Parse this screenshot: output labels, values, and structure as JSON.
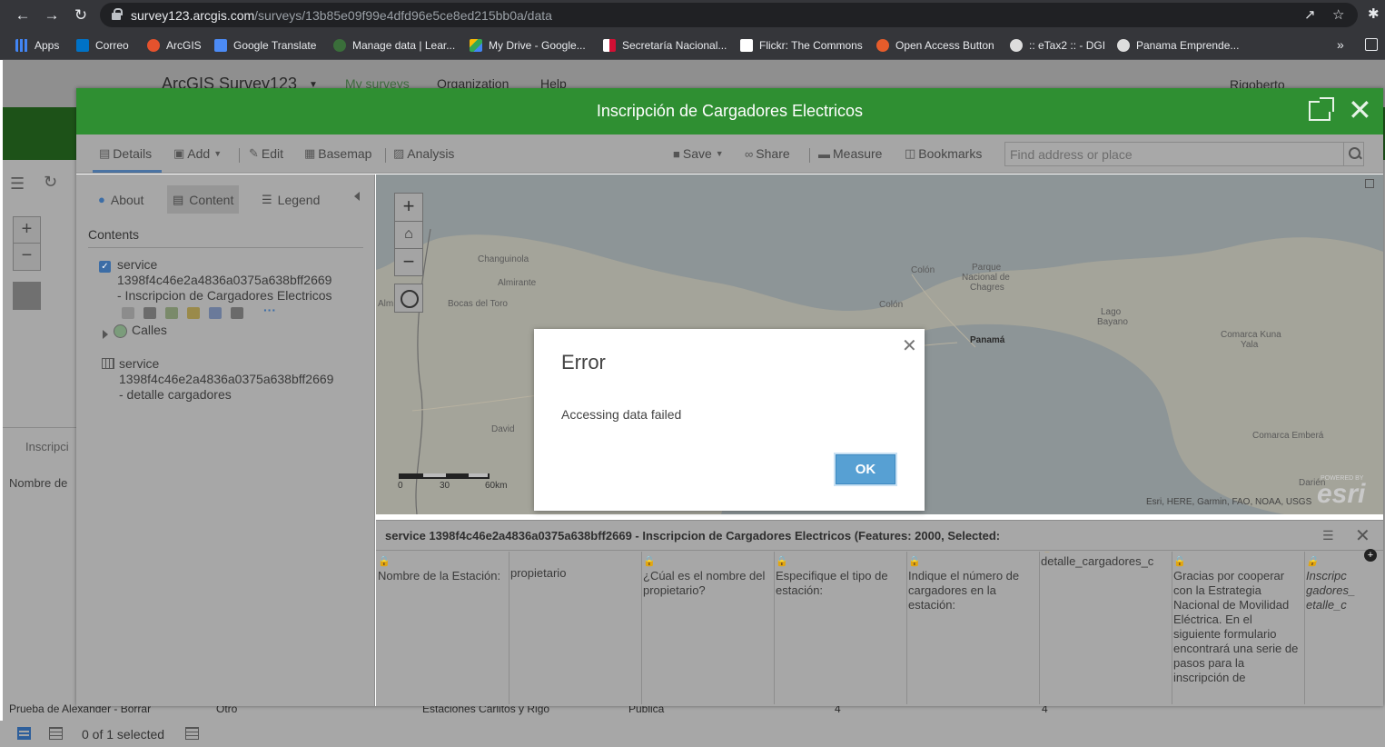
{
  "browser": {
    "url_host": "survey123.arcgis.com",
    "url_path": "/surveys/13b85e09f99e4dfd96e5ce8ed215bb0a/data",
    "bookmarks": [
      "Apps",
      "Correo",
      "ArcGIS",
      "Google Translate",
      "Manage data | Lear...",
      "My Drive - Google...",
      "Secretaría Nacional...",
      "Flickr: The Commons",
      "Open Access Button",
      ":: eTax2 :: - DGI",
      "Panama Emprende..."
    ],
    "more": "»"
  },
  "app": {
    "brand": "ArcGIS Survey123",
    "nav": [
      "My surveys",
      "Organization",
      "Help"
    ],
    "user": "Rigoberto",
    "bg_title": "Inscripci",
    "bg_field": "Nombre de",
    "row_values": [
      "Prueba de Alexander - Borrar",
      "Otro",
      "Estaciones Carlitos y Rigo",
      "Publica",
      "4",
      "4"
    ],
    "selection_status": "0 of 1 selected"
  },
  "modal": {
    "title": "Inscripción de Cargadores Electricos",
    "toolbar": {
      "details": "Details",
      "add": "Add",
      "edit": "Edit",
      "basemap": "Basemap",
      "analysis": "Analysis",
      "save": "Save",
      "share": "Share",
      "measure": "Measure",
      "bookmarks": "Bookmarks",
      "search_placeholder": "Find address or place"
    },
    "side": {
      "tabs": [
        "About",
        "Content",
        "Legend"
      ],
      "contents_label": "Contents",
      "layer1": [
        "service",
        "1398f4c46e2a4836a0375a638bff2669",
        "- Inscripcion de Cargadores Electricos"
      ],
      "layer1_more": "···",
      "sublayer": "Calles",
      "layer2": [
        "service",
        "1398f4c46e2a4836a0375a638bff2669",
        "- detalle cargadores"
      ]
    },
    "map": {
      "labels": [
        "Changuinola",
        "Almirante",
        "Bocas del Toro",
        "Colón",
        "Parque",
        "Nacional de",
        "Chagres",
        "Colón",
        "Panamá",
        "Lago",
        "Bayano",
        "Comarca Kuna",
        "Yala",
        "Comarca Emberá",
        "Darién",
        "David",
        "Alm"
      ],
      "scale_labels": [
        "0",
        "30",
        "60km"
      ],
      "attribution": "Esri, HERE, Garmin, FAO, NOAA, USGS",
      "logo": "esri",
      "logo_powered": "POWERED BY"
    },
    "table": {
      "title": "service 1398f4c46e2a4836a0375a638bff2669 - Inscripcion de Cargadores Electricos (Features: 2000, Selected:",
      "columns": [
        "Nombre de la Estación:",
        "propietario",
        "¿Cúal es el nombre del propietario?",
        "Especifique el tipo de estación:",
        "Indique el número de cargadores en la estación:",
        "detalle_cargadores_c",
        "Gracias por cooperar con la Estrategia Nacional de Movilidad Eléctrica. En el siguiente formulario encontrará una serie de pasos para la inscripción de",
        "Inscripc gadores_ etalle_c"
      ]
    }
  },
  "dialog": {
    "title": "Error",
    "message": "Accessing data failed",
    "ok": "OK"
  }
}
